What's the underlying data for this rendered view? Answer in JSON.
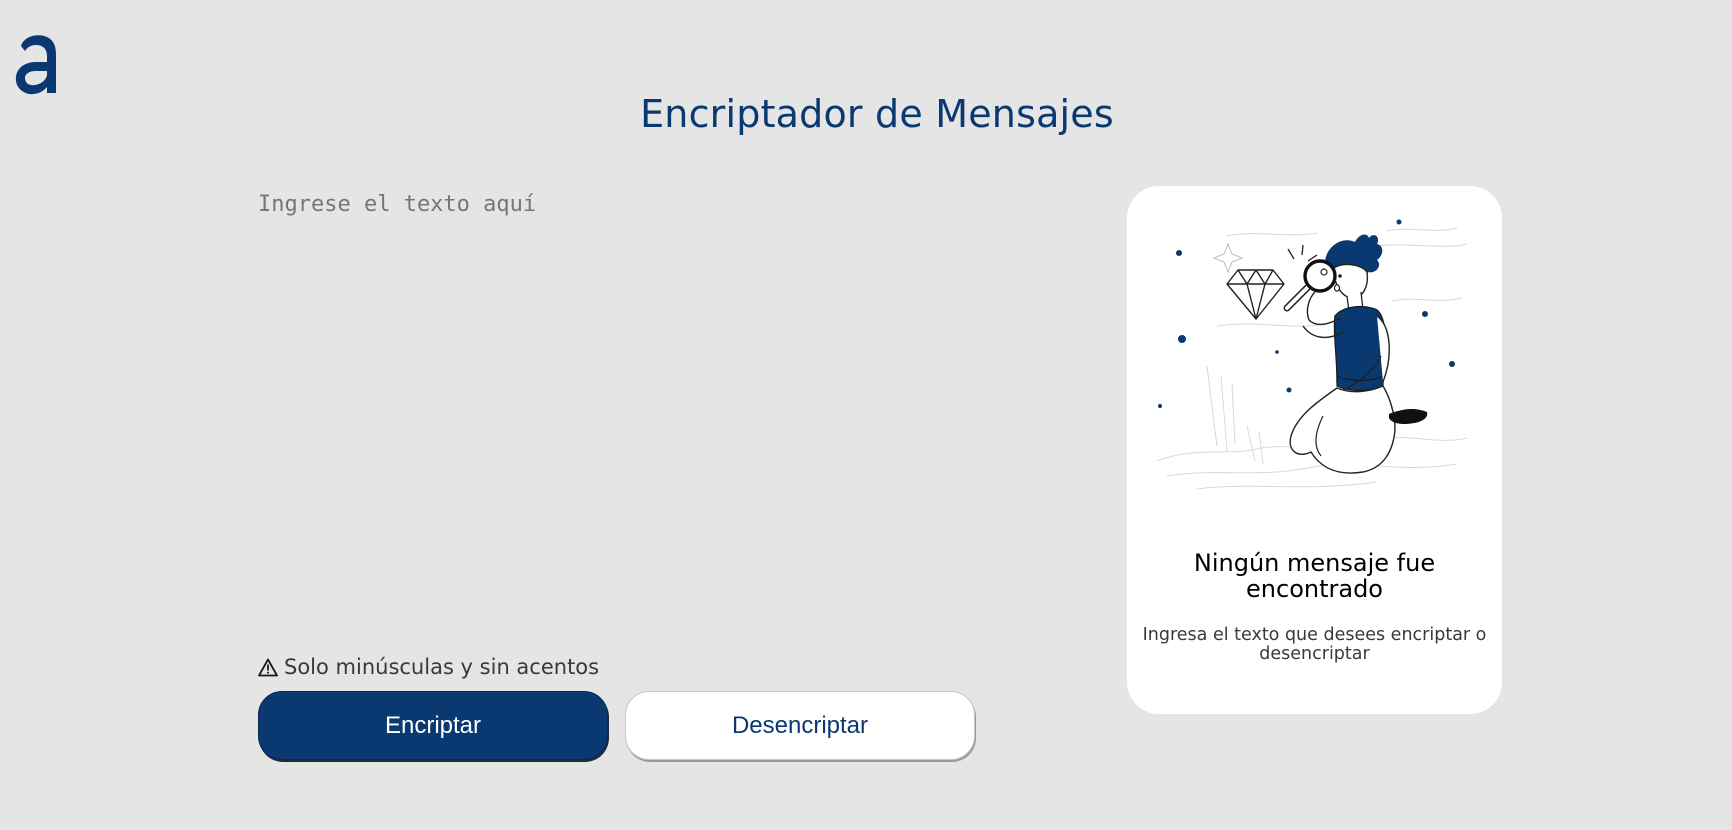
{
  "header": {
    "logo_icon": "alura-a-logo",
    "title": "Encriptador de Mensajes"
  },
  "input": {
    "placeholder": "Ingrese el texto aquí",
    "value": ""
  },
  "hint": {
    "icon": "warning-triangle-icon",
    "text": "Solo minúsculas y sin acentos"
  },
  "buttons": {
    "encrypt_label": "Encriptar",
    "decrypt_label": "Desencriptar"
  },
  "output_card": {
    "illustration": "person-with-magnifying-glass-and-diamond",
    "title": "Ningún mensaje fue encontrado",
    "text": "Ingresa el texto que desees encriptar o desencriptar"
  },
  "colors": {
    "background": "#e5e5e5",
    "primary": "#0a3871",
    "card": "#ffffff"
  }
}
